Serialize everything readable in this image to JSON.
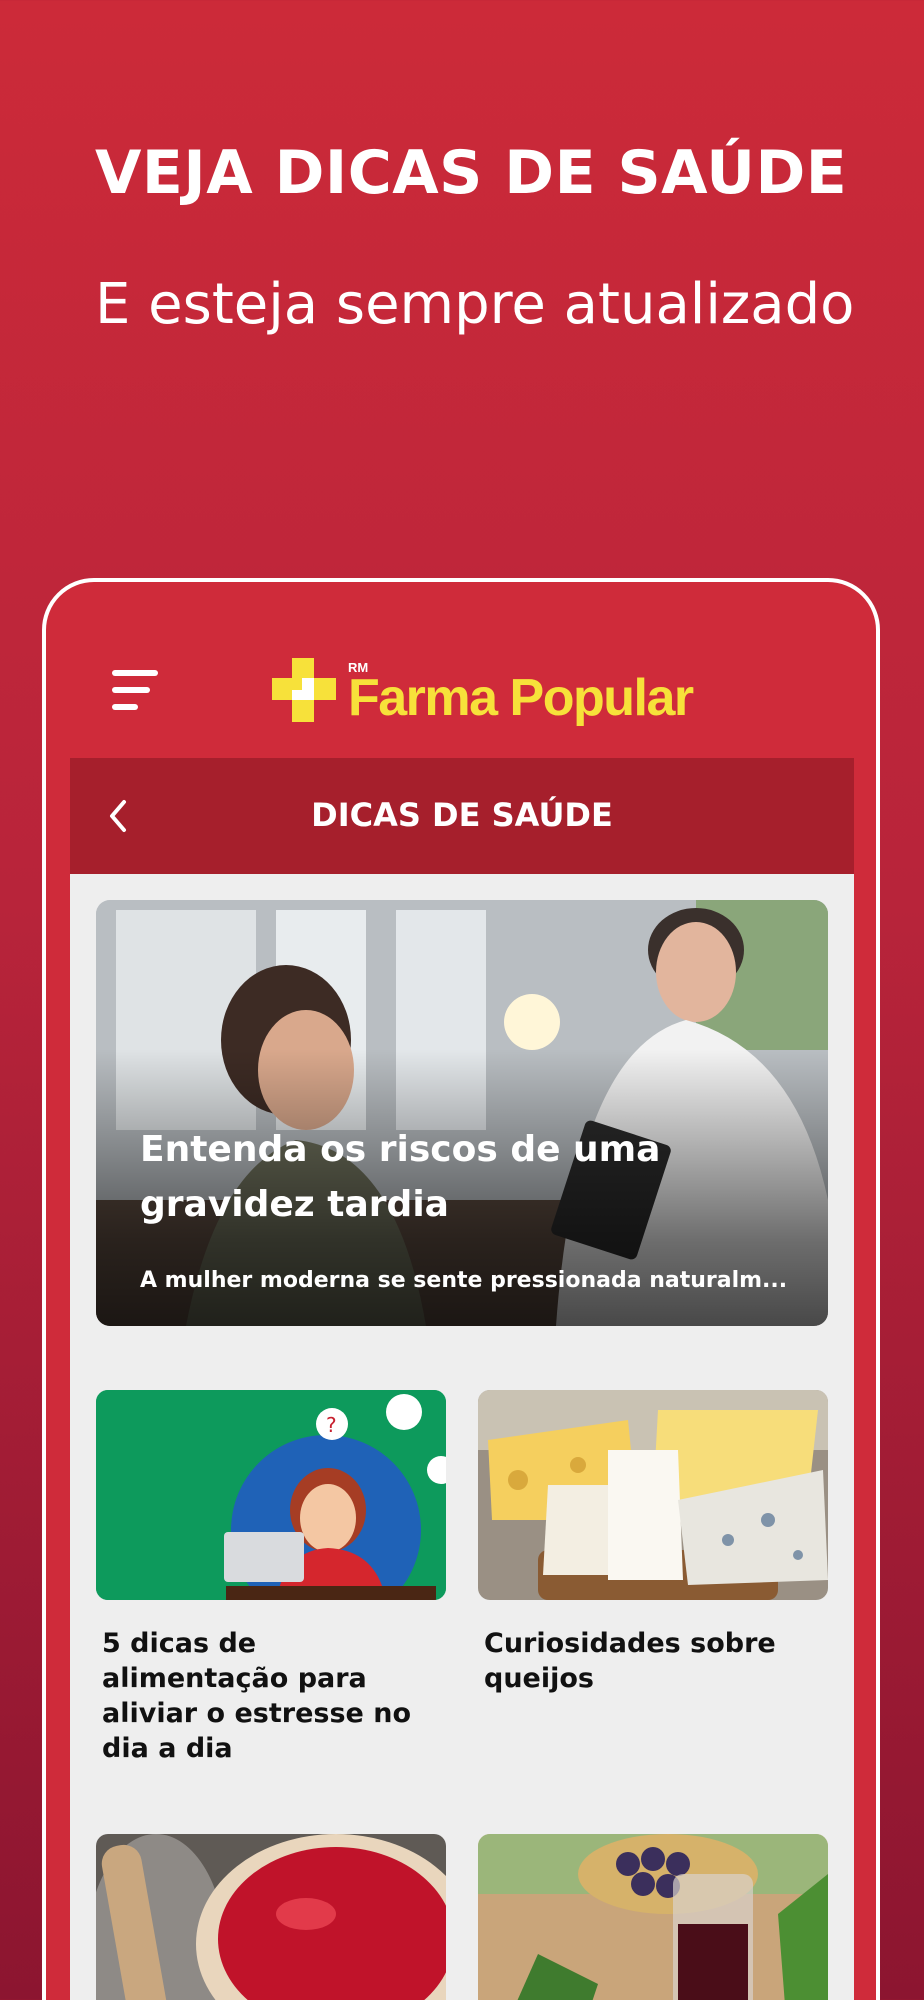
{
  "promo": {
    "title": "VEJA DICAS DE SAÚDE",
    "subtitle": "E esteja sempre atualizado"
  },
  "app": {
    "logo_rm": "RM",
    "logo_text": "Farma Popular",
    "section_title": "DICAS DE SAÚDE"
  },
  "featured": {
    "title": "Entenda os riscos de uma gravidez tardia",
    "description": "A mulher moderna se sente pressionada naturalm..."
  },
  "articles": [
    {
      "title": "5 dicas de alimentação para aliviar o estresse no dia a dia"
    },
    {
      "title": "Curiosidades sobre queijos"
    },
    {
      "title": ""
    },
    {
      "title": ""
    }
  ],
  "colors": {
    "brand_red": "#cf2b3a",
    "header_dark_red": "#a61f2c",
    "logo_yellow": "#f7e13a"
  },
  "icons": [
    "menu-icon",
    "back-icon",
    "logo-cross-icon"
  ]
}
